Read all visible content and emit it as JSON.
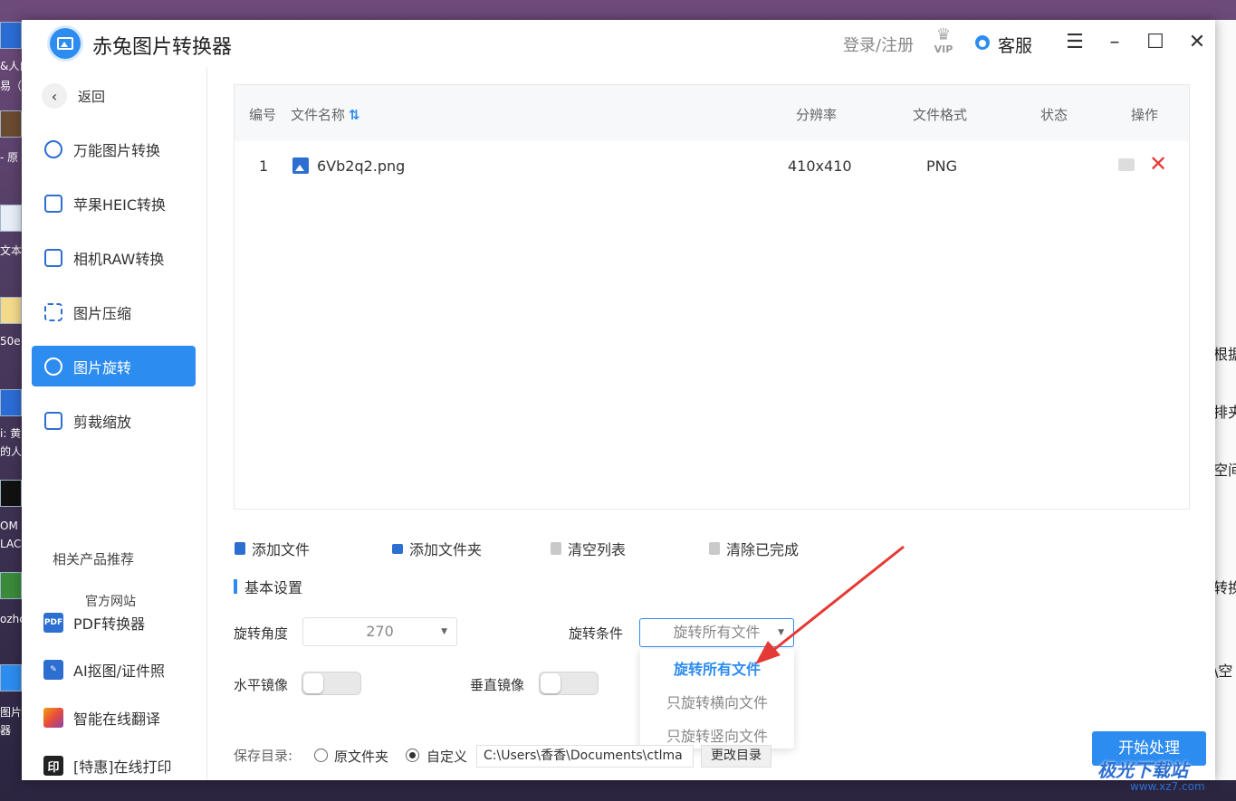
{
  "desktop": {
    "left_texts": [
      "&人白",
      "易（",
      "- 原",
      "文本",
      "50e",
      "i: 黄",
      "的人",
      "OM",
      "LAC",
      "ozhc",
      "图片",
      "器"
    ],
    "right_texts": [
      "根据",
      "排夹",
      "空间",
      "转换",
      "\\空"
    ]
  },
  "titlebar": {
    "app_title": "赤兔图片转换器",
    "login_label": "登录/注册",
    "vip_label": "VIP",
    "service_label": "客服",
    "menu_icon": "hamburger-icon",
    "minimize_icon": "minimize-icon",
    "maximize_icon": "maximize-icon",
    "close_icon": "close-icon"
  },
  "sidebar": {
    "back_label": "返回",
    "items": [
      {
        "label": "万能图片转换",
        "icon": "image-convert-icon"
      },
      {
        "label": "苹果HEIC转换",
        "icon": "heic-icon"
      },
      {
        "label": "相机RAW转换",
        "icon": "raw-icon"
      },
      {
        "label": "图片压缩",
        "icon": "compress-icon"
      },
      {
        "label": "图片旋转",
        "icon": "rotate-icon",
        "active": true
      },
      {
        "label": "剪裁缩放",
        "icon": "crop-icon"
      }
    ],
    "recommend_title": "相关产品推荐",
    "official_site": "官方网站",
    "products": [
      {
        "label": "PDF转换器",
        "icon": "pdf-icon",
        "color": "#2d6fd1",
        "badge": "PDF"
      },
      {
        "label": "AI抠图/证件照",
        "icon": "ai-cutout-icon",
        "color": "#2d6fd1",
        "badge": ""
      },
      {
        "label": "智能在线翻译",
        "icon": "translate-icon",
        "color": "#f39c12",
        "badge": ""
      },
      {
        "label": "[特惠]在线打印",
        "icon": "print-icon",
        "color": "#222222",
        "badge": "印"
      }
    ]
  },
  "table": {
    "headers": {
      "index": "编号",
      "name": "文件名称",
      "resolution": "分辨率",
      "format": "文件格式",
      "status": "状态",
      "action": "操作"
    },
    "rows": [
      {
        "index": "1",
        "name": "6Vb2q2.png",
        "resolution": "410x410",
        "format": "PNG",
        "status": ""
      }
    ]
  },
  "toolbar": {
    "add_file": "添加文件",
    "add_folder": "添加文件夹",
    "clear_list": "清空列表",
    "clear_done": "清除已完成"
  },
  "settings": {
    "section_title": "基本设置",
    "angle_label": "旋转角度",
    "angle_value": "270",
    "condition_label": "旋转条件",
    "condition_value": "旋转所有文件",
    "condition_options": [
      "旋转所有文件",
      "只旋转横向文件",
      "只旋转竖向文件"
    ],
    "hmirror_label": "水平镜像",
    "vmirror_label": "垂直镜像",
    "save_label": "保存目录:",
    "radio_original": "原文件夹",
    "radio_custom": "自定义",
    "path_value": "C:\\Users\\香香\\Documents\\ctlma",
    "change_dir": "更改目录",
    "start": "开始处理"
  },
  "watermark": {
    "text": "极光下载站",
    "url": "www.xz7.com"
  },
  "colors": {
    "accent": "#2d8cf0",
    "delete": "#e53935"
  }
}
